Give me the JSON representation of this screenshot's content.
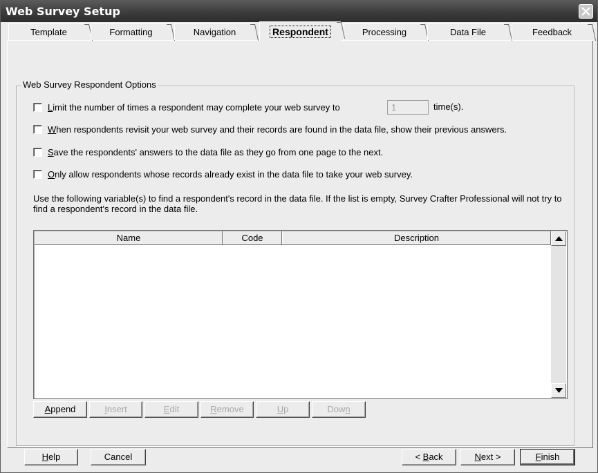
{
  "window": {
    "title": "Web Survey Setup"
  },
  "tabs": [
    {
      "label": "Template"
    },
    {
      "label": "Formatting"
    },
    {
      "label": "Navigation"
    },
    {
      "label": "Respondent"
    },
    {
      "label": "Processing"
    },
    {
      "label": "Data File"
    },
    {
      "label": "Feedback"
    }
  ],
  "group": {
    "title": "Web Survey Respondent Options"
  },
  "options": [
    {
      "hotkey": "L",
      "rest": "imit the number of times a respondent may complete your web survey to",
      "checked": false
    },
    {
      "hotkey": "W",
      "rest": "hen respondents revisit your web survey and their records are found in the data file, show their previous answers.",
      "checked": false
    },
    {
      "hotkey": "S",
      "rest": "ave the respondents' answers to the data file as they go from one page to the next.",
      "checked": false
    },
    {
      "hotkey": "O",
      "rest": "nly allow respondents whose records already exist in the data file to take your web survey.",
      "checked": false
    }
  ],
  "limit": {
    "value": "1",
    "suffix": "time(s)."
  },
  "info_text": "Use the following variable(s) to find a respondent's record in the data file. If the list is empty, Survey Crafter Professional will not try to find a respondent's record in the data file.",
  "list": {
    "columns": [
      "Name",
      "Code",
      "Description"
    ],
    "rows": []
  },
  "list_buttons": [
    {
      "hotkey": "A",
      "rest": "ppend",
      "enabled": true
    },
    {
      "hotkey": "I",
      "rest": "nsert",
      "enabled": false
    },
    {
      "hotkey": "E",
      "rest": "dit",
      "enabled": false
    },
    {
      "hotkey": "R",
      "rest": "emove",
      "enabled": false
    },
    {
      "hotkey": "U",
      "rest": "p",
      "enabled": false
    },
    {
      "pre": "Dow",
      "hotkey": "n",
      "enabled": false
    }
  ],
  "footer": {
    "help": {
      "hotkey": "H",
      "rest": "elp"
    },
    "cancel": "Cancel",
    "back": {
      "pre": "< ",
      "hotkey": "B",
      "rest": "ack"
    },
    "next": {
      "hotkey": "N",
      "rest": "ext >"
    },
    "finish": {
      "hotkey": "F",
      "rest": "inish"
    }
  }
}
